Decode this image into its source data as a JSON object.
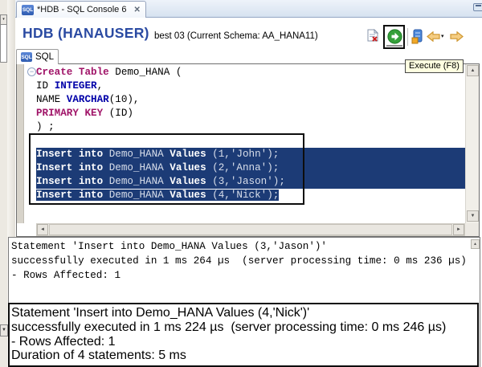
{
  "window": {
    "tab_title": "*HDB - SQL Console 6",
    "tab_icon_label": "SQL"
  },
  "header": {
    "title": "HDB (HANAUSER)",
    "subtitle": "best 03 (Current Schema: AA_HANA11)"
  },
  "toolbar": {
    "tooltip": "Execute (F8)",
    "buttons": [
      "clear",
      "execute",
      "commit",
      "back",
      "back-menu",
      "forward"
    ]
  },
  "editor_tab": {
    "label": "SQL",
    "icon_label": "SQL"
  },
  "editor": {
    "lines": [
      {
        "fold": true,
        "tokens": [
          [
            "kw",
            "Create Table"
          ],
          [
            "pl",
            " Demo_HANA ("
          ]
        ]
      },
      {
        "tokens": [
          [
            "pl",
            "ID "
          ],
          [
            "ty",
            "INTEGER"
          ],
          [
            "pl",
            ","
          ]
        ]
      },
      {
        "tokens": [
          [
            "pl",
            "NAME "
          ],
          [
            "ty",
            "VARCHAR"
          ],
          [
            "pl",
            "(10),"
          ]
        ]
      },
      {
        "tokens": [
          [
            "kw",
            "PRIMARY KEY"
          ],
          [
            "pl",
            " (ID)"
          ]
        ]
      },
      {
        "tokens": [
          [
            "pl",
            ") ;"
          ]
        ]
      },
      {
        "tokens": []
      },
      {
        "sel": "full",
        "tokens": [
          [
            "sb",
            "Insert into "
          ],
          [
            "sp",
            "Demo_HANA "
          ],
          [
            "sb",
            "Values "
          ],
          [
            "sp",
            "(1,'John');"
          ]
        ]
      },
      {
        "sel": "full",
        "tokens": [
          [
            "sb",
            "Insert into "
          ],
          [
            "sp",
            "Demo_HANA "
          ],
          [
            "sb",
            "Values "
          ],
          [
            "sp",
            "(2,'Anna');"
          ]
        ]
      },
      {
        "sel": "full",
        "tokens": [
          [
            "sb",
            "Insert into "
          ],
          [
            "sp",
            "Demo_HANA "
          ],
          [
            "sb",
            "Values "
          ],
          [
            "sp",
            "(3,'Jason');"
          ]
        ]
      },
      {
        "sel": "text",
        "tokens": [
          [
            "sb",
            "Insert into "
          ],
          [
            "sp",
            "Demo_HANA "
          ],
          [
            "sb",
            "Values "
          ],
          [
            "sp",
            "(4,'Nick');"
          ]
        ]
      }
    ]
  },
  "results": {
    "blocks": [
      {
        "lines": [
          "Statement 'Insert into Demo_HANA Values (3,'Jason')'",
          "successfully executed in 1 ms 264 µs  (server processing time: 0 ms 236 µs)",
          "- Rows Affected: 1"
        ]
      },
      {
        "highlighted": true,
        "lines": [
          "Statement 'Insert into Demo_HANA Values (4,'Nick')'",
          "successfully executed in 1 ms 224 µs  (server processing time: 0 ms 246 µs)",
          "- Rows Affected: 1",
          "Duration of 4 statements: 5 ms"
        ]
      }
    ]
  },
  "icons": {
    "tab_close": "✕",
    "fold_collapse": "−",
    "dropdown": "▾",
    "scroll_up": "▲",
    "scroll_down": "▼",
    "scroll_left": "◄",
    "scroll_right": "►"
  },
  "colors": {
    "selection_blue": "#1c3b76",
    "keyword_magenta": "#a01468",
    "datatype_blue": "#0202a8",
    "header_blue": "#2a4aa2",
    "execute_green": "#35a03a",
    "arrow_gold": "#f5cd82",
    "tooltip_bg": "#ffffe1",
    "annotation_black": "#0d0d0d"
  }
}
